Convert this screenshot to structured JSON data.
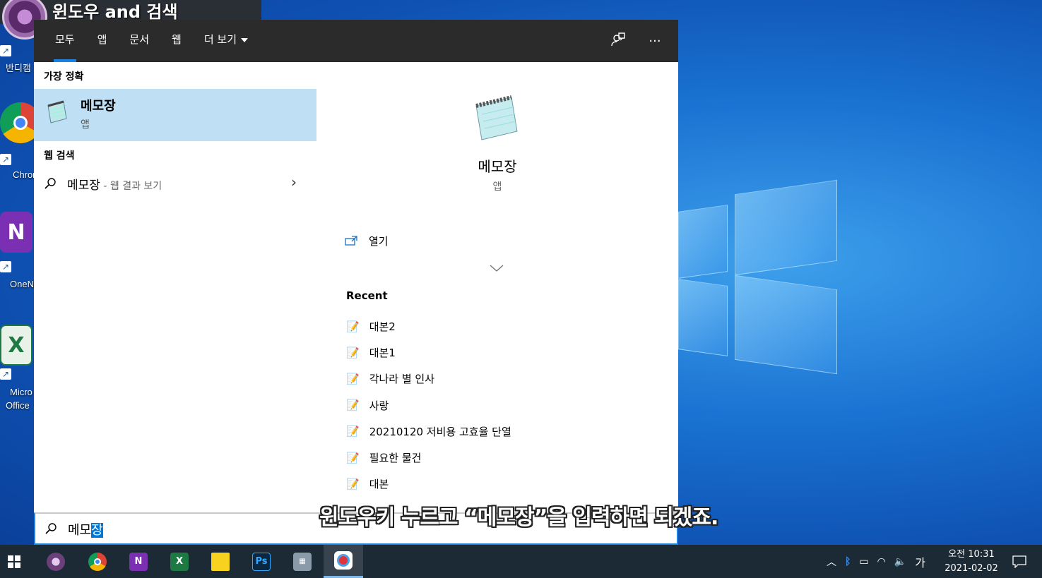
{
  "video": {
    "title": "윈도우 and 검색"
  },
  "desktop": {
    "icons": [
      {
        "label": "반디캠"
      },
      {
        "label": "Chrome"
      },
      {
        "label": "OneNote"
      },
      {
        "label": "Micro",
        "label2": "Office"
      }
    ]
  },
  "search": {
    "tabs": [
      {
        "label": "모두"
      },
      {
        "label": "앱"
      },
      {
        "label": "문서"
      },
      {
        "label": "웹"
      },
      {
        "label": "더 보기"
      }
    ],
    "best_match_title": "가장 정확",
    "best_match": {
      "name": "메모장",
      "type": "앱"
    },
    "web_section_title": "웹 검색",
    "web_result": {
      "term": "메모장",
      "suffix": " - 웹 결과 보기"
    },
    "preview": {
      "name": "메모장",
      "type": "앱",
      "open_label": "열기",
      "recent_title": "Recent",
      "recent": [
        "대본2",
        "대본1",
        "각나라 별 인사",
        "사랑",
        "20210120 저비용 고효율 단열",
        "필요한 물건",
        "대본"
      ]
    },
    "query_typed": "메모",
    "query_selected": "장"
  },
  "caption": "윈도우키 누르고 “메모장”을 입력하면 되겠죠.",
  "taskbar": {
    "ime": "가",
    "time": "오전 10:31",
    "date": "2021-02-02"
  },
  "colors": {
    "accent": "#1a82e2",
    "best_match_bg": "#bfdff5",
    "topbar_bg": "#2b2b2b",
    "taskbar_bg": "#1c2a36"
  }
}
